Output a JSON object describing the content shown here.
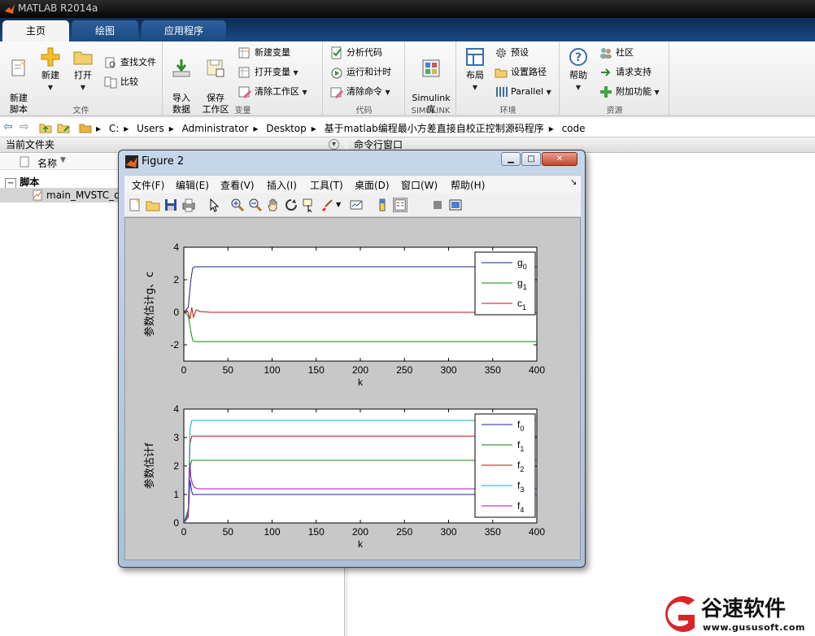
{
  "app": {
    "title": "MATLAB R2014a"
  },
  "tabs": [
    {
      "label": "主页"
    },
    {
      "label": "绘图"
    },
    {
      "label": "应用程序"
    }
  ],
  "ribbon": {
    "file_group": {
      "name": "文件",
      "new_script": "新建\n脚本",
      "new": "新建",
      "open": "打开",
      "find_files": "查找文件",
      "compare": "比较"
    },
    "variable_group": {
      "name": "变量",
      "import": "导入\n数据",
      "save_ws": "保存\n工作区",
      "new_var": "新建变量",
      "open_var": "打开变量",
      "clear_ws": "清除工作区"
    },
    "code_group": {
      "name": "代码",
      "analyze": "分析代码",
      "run_time": "运行和计时",
      "clear_cmd": "清除命令"
    },
    "simulink_group": {
      "name": "SIMULINK",
      "lib": "Simulink\n库"
    },
    "env_group": {
      "name": "环境",
      "layout": "布局",
      "prefs": "预设",
      "set_path": "设置路径",
      "parallel": "Parallel"
    },
    "resources_group": {
      "name": "资源",
      "help": "帮助",
      "community": "社区",
      "support": "请求支持",
      "addons": "附加功能"
    }
  },
  "address": {
    "crumbs": [
      "C:",
      "Users",
      "Administrator",
      "Desktop",
      "基于matlab编程最小方差直接自校正控制源码程序",
      "code"
    ]
  },
  "left_panel": {
    "title": "当前文件夹",
    "col_name": "名称",
    "group": "脚本",
    "file": "main_MVSTC_d"
  },
  "cmd_panel": {
    "title": "命令行窗口"
  },
  "figure": {
    "title": "Figure 2",
    "menu": [
      "文件(F)",
      "编辑(E)",
      "查看(V)",
      "插入(I)",
      "工具(T)",
      "桌面(D)",
      "窗口(W)",
      "帮助(H)"
    ]
  },
  "watermark": {
    "brand": "谷速软件",
    "url": "www.gususoft.com"
  },
  "colors": {
    "ribbon_tab": "#1d4a82",
    "blue": "#1f1fa0",
    "green": "#0a8a0a",
    "red": "#c01010",
    "cyan": "#10b0b0",
    "magenta": "#b010b0"
  },
  "chart_data": [
    {
      "type": "line",
      "xlabel": "k",
      "ylabel": "参数估计g、c",
      "xlim": [
        0,
        400
      ],
      "ylim": [
        -3,
        4
      ],
      "xticks": [
        0,
        50,
        100,
        150,
        200,
        250,
        300,
        350,
        400
      ],
      "yticks": [
        -2,
        0,
        2,
        4
      ],
      "legend_position": "top-right",
      "series": [
        {
          "name": "g0",
          "color": "#1f1fa0",
          "x": [
            0,
            5,
            8,
            10,
            12,
            20,
            400
          ],
          "y": [
            0,
            0.3,
            2.0,
            2.7,
            2.8,
            2.8,
            2.8
          ]
        },
        {
          "name": "g1",
          "color": "#0a8a0a",
          "x": [
            0,
            5,
            8,
            10,
            12,
            20,
            400
          ],
          "y": [
            0,
            -0.2,
            -1.2,
            -1.7,
            -1.8,
            -1.8,
            -1.8
          ]
        },
        {
          "name": "c1",
          "color": "#c01010",
          "x": [
            0,
            4,
            7,
            9,
            11,
            14,
            18,
            30,
            400
          ],
          "y": [
            0,
            0.1,
            -0.4,
            0.3,
            -0.3,
            0.15,
            0.05,
            0.0,
            0.0
          ]
        }
      ]
    },
    {
      "type": "line",
      "xlabel": "k",
      "ylabel": "参数估计f",
      "xlim": [
        0,
        400
      ],
      "ylim": [
        0,
        4
      ],
      "xticks": [
        0,
        50,
        100,
        150,
        200,
        250,
        300,
        350,
        400
      ],
      "yticks": [
        0,
        1,
        2,
        3,
        4
      ],
      "legend_position": "top-right",
      "series": [
        {
          "name": "f0",
          "color": "#1f1fa0",
          "x": [
            0,
            5,
            7,
            9,
            10,
            14,
            400
          ],
          "y": [
            0,
            0.2,
            1.5,
            1.1,
            1.0,
            1.0,
            1.0
          ]
        },
        {
          "name": "f1",
          "color": "#0a8a0a",
          "x": [
            0,
            5,
            7,
            9,
            14,
            400
          ],
          "y": [
            0,
            0.3,
            2.0,
            2.2,
            2.2,
            2.2
          ]
        },
        {
          "name": "f2",
          "color": "#c01010",
          "x": [
            0,
            5,
            7,
            9,
            14,
            400
          ],
          "y": [
            0,
            0.4,
            2.8,
            3.05,
            3.05,
            3.05
          ]
        },
        {
          "name": "f3",
          "color": "#10b0b0",
          "x": [
            0,
            5,
            7,
            9,
            14,
            400
          ],
          "y": [
            0,
            0.5,
            3.3,
            3.6,
            3.6,
            3.6
          ]
        },
        {
          "name": "f4",
          "color": "#b010b0",
          "x": [
            0,
            5,
            7,
            8,
            10,
            12,
            16,
            400
          ],
          "y": [
            0,
            0.2,
            2.1,
            1.6,
            1.35,
            1.25,
            1.2,
            1.2
          ]
        }
      ]
    }
  ]
}
